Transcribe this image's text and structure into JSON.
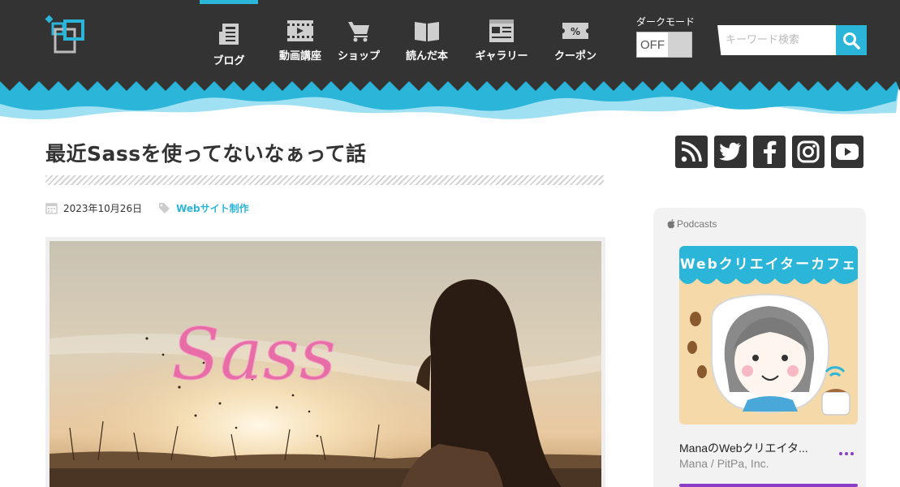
{
  "header": {
    "nav": [
      {
        "label": "ブログ",
        "icon": "blog-icon",
        "active": true
      },
      {
        "label": "動画講座",
        "icon": "video-icon",
        "active": false
      },
      {
        "label": "ショップ",
        "icon": "cart-icon",
        "active": false
      },
      {
        "label": "読んだ本",
        "icon": "book-icon",
        "active": false
      },
      {
        "label": "ギャラリー",
        "icon": "gallery-icon",
        "active": false
      },
      {
        "label": "クーポン",
        "icon": "coupon-icon",
        "active": false
      }
    ],
    "dark_mode": {
      "label": "ダークモード",
      "state": "OFF"
    },
    "search": {
      "placeholder": "キーワード検索"
    }
  },
  "post": {
    "title": "最近Sassを使ってないなぁって話",
    "date": "2023年10月26日",
    "category": "Webサイト制作",
    "hero_logo_text": "Sass"
  },
  "sidebar": {
    "social": [
      "rss-icon",
      "twitter-icon",
      "facebook-icon",
      "instagram-icon",
      "youtube-icon"
    ],
    "podcast": {
      "brand": "Podcasts",
      "artwork_title": "Webクリエイターカフェ",
      "show": "ManaのWebクリエイタ...",
      "author": "Mana / PitPa, Inc."
    }
  },
  "colors": {
    "header_bg": "#333333",
    "accent": "#2bb5d8",
    "podcast_accent": "#8a3ec8"
  }
}
